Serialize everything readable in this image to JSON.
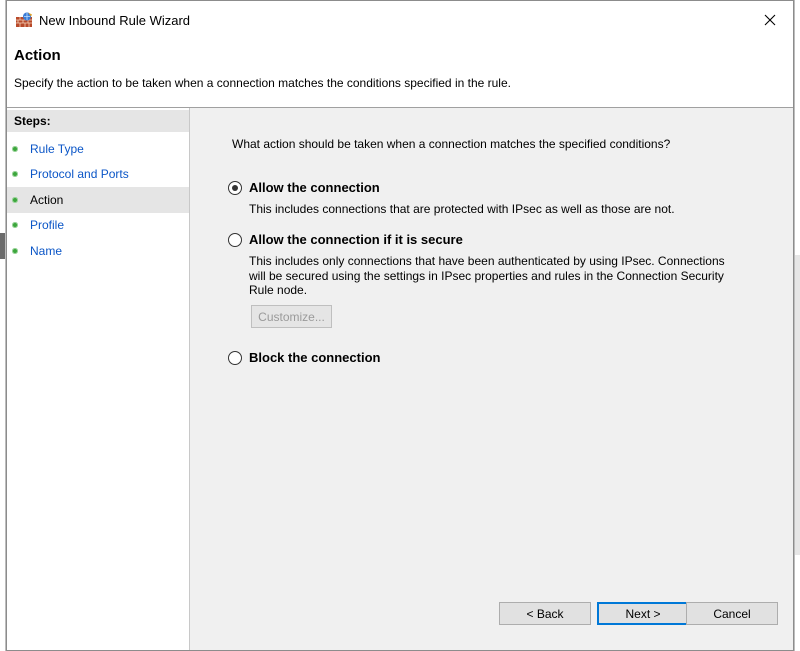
{
  "window": {
    "title": "New Inbound Rule Wizard"
  },
  "header": {
    "title": "Action",
    "description": "Specify the action to be taken when a connection matches the conditions specified in the rule."
  },
  "steps": {
    "heading": "Steps:",
    "items": [
      {
        "label": "Rule Type",
        "active": false
      },
      {
        "label": "Protocol and Ports",
        "active": false
      },
      {
        "label": "Action",
        "active": true
      },
      {
        "label": "Profile",
        "active": false
      },
      {
        "label": "Name",
        "active": false
      }
    ]
  },
  "content": {
    "question": "What action should be taken when a connection matches the specified conditions?",
    "options": {
      "allow": {
        "label": "Allow the connection",
        "description": "This includes connections that are protected with IPsec as well as those are not.",
        "checked": true
      },
      "allow_secure": {
        "label": "Allow the connection if it is secure",
        "description": "This includes only connections that have been authenticated by using IPsec.  Connections will be secured using the settings in IPsec properties and rules in the Connection Security Rule node.",
        "checked": false
      },
      "block": {
        "label": "Block the connection",
        "checked": false
      }
    },
    "customize_label": "Customize..."
  },
  "buttons": {
    "back": "< Back",
    "next": "Next >",
    "cancel": "Cancel"
  },
  "colors": {
    "link_blue": "#0b56c7",
    "step_dot_green": "#3ca63c",
    "focus_blue": "#0078d7"
  }
}
